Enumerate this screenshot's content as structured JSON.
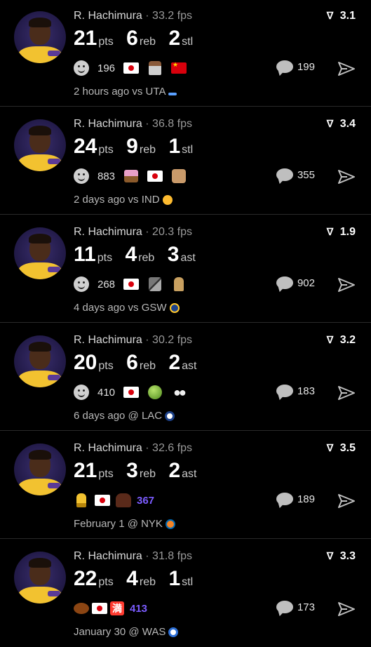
{
  "feed": [
    {
      "player": "R. Hachimura",
      "separator": "·",
      "fps": "33.2 fps",
      "rating": "3.1",
      "stats": [
        {
          "value": "21",
          "unit": "pts"
        },
        {
          "value": "6",
          "unit": "reb"
        },
        {
          "value": "2",
          "unit": "stl"
        }
      ],
      "reaction_count": "196",
      "reaction_icons": [
        "flag-japan-icon",
        "man-emoji-icon",
        "flag-china-icon"
      ],
      "comment_count": "199",
      "time": "2 hours ago vs UTA",
      "team_icon": "jazz-logo-icon",
      "team_color": "#5aa0ff"
    },
    {
      "player": "R. Hachimura",
      "separator": "·",
      "fps": "36.8 fps",
      "rating": "3.4",
      "stats": [
        {
          "value": "24",
          "unit": "pts"
        },
        {
          "value": "9",
          "unit": "reb"
        },
        {
          "value": "1",
          "unit": "stl"
        }
      ],
      "reaction_count": "883",
      "reaction_icons": [
        "cake-emoji-icon",
        "flag-japan-icon",
        "face-emoji-icon"
      ],
      "comment_count": "355",
      "time": "2 days ago vs IND",
      "team_icon": "pacers-logo-icon",
      "team_color": "#fdbb30"
    },
    {
      "player": "R. Hachimura",
      "separator": "·",
      "fps": "20.3 fps",
      "rating": "1.9",
      "stats": [
        {
          "value": "11",
          "unit": "pts"
        },
        {
          "value": "4",
          "unit": "reb"
        },
        {
          "value": "3",
          "unit": "ast"
        }
      ],
      "reaction_count": "268",
      "reaction_icons": [
        "flag-japan-icon",
        "sword-emoji-icon",
        "spartan-emoji-icon"
      ],
      "comment_count": "902",
      "time": "4 days ago vs GSW",
      "team_icon": "warriors-logo-icon",
      "team_color": "#1d428a"
    },
    {
      "player": "R. Hachimura",
      "separator": "·",
      "fps": "30.2 fps",
      "rating": "3.2",
      "stats": [
        {
          "value": "20",
          "unit": "pts"
        },
        {
          "value": "6",
          "unit": "reb"
        },
        {
          "value": "2",
          "unit": "ast"
        }
      ],
      "reaction_count": "410",
      "reaction_icons": [
        "flag-japan-icon",
        "melon-emoji-icon",
        "eyes-emoji-icon"
      ],
      "comment_count": "183",
      "time": "6 days ago @ LAC",
      "team_icon": "clippers-logo-icon",
      "team_color": "#1d428a"
    },
    {
      "player": "R. Hachimura",
      "separator": "·",
      "fps": "32.6 fps",
      "rating": "3.5",
      "stats": [
        {
          "value": "21",
          "unit": "pts"
        },
        {
          "value": "3",
          "unit": "reb"
        },
        {
          "value": "2",
          "unit": "ast"
        }
      ],
      "reaction_count": "367",
      "reaction_icons": [
        "trophy-emoji-icon",
        "flag-japan-icon",
        "hair-emoji-icon"
      ],
      "comment_count": "189",
      "time": "February 1 @ NYK",
      "team_icon": "knicks-logo-icon",
      "team_color": "#f58426"
    },
    {
      "player": "R. Hachimura",
      "separator": "·",
      "fps": "31.8 fps",
      "rating": "3.3",
      "stats": [
        {
          "value": "22",
          "unit": "pts"
        },
        {
          "value": "4",
          "unit": "reb"
        },
        {
          "value": "1",
          "unit": "stl"
        }
      ],
      "reaction_count": "413",
      "reaction_icons": [
        "football-emoji-icon",
        "flag-japan-icon",
        "kanji-full-emoji-icon"
      ],
      "reaction_kanji": "満",
      "comment_count": "173",
      "time": "January 30 @ WAS",
      "team_icon": "wizards-logo-icon",
      "team_color": "#2d6fd6"
    }
  ]
}
